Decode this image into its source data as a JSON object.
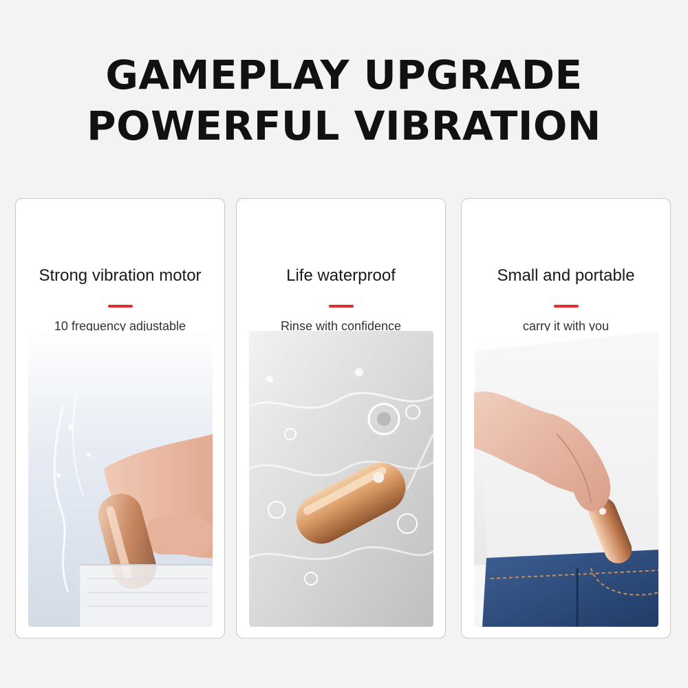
{
  "headline": {
    "line1": "GAMEPLAY UPGRADE",
    "line2": "POWERFUL VIBRATION"
  },
  "cards": [
    {
      "title": "Strong vibration motor",
      "subtitle": "10 frequency adjustable"
    },
    {
      "title": "Life waterproof",
      "subtitle": "Rinse with confidence"
    },
    {
      "title": "Small and portable",
      "subtitle": "carry it with you"
    }
  ],
  "colors": {
    "background": "#f3f3f3",
    "accent_dash": "#e62a2a",
    "product_gold": "#d9a07a"
  }
}
